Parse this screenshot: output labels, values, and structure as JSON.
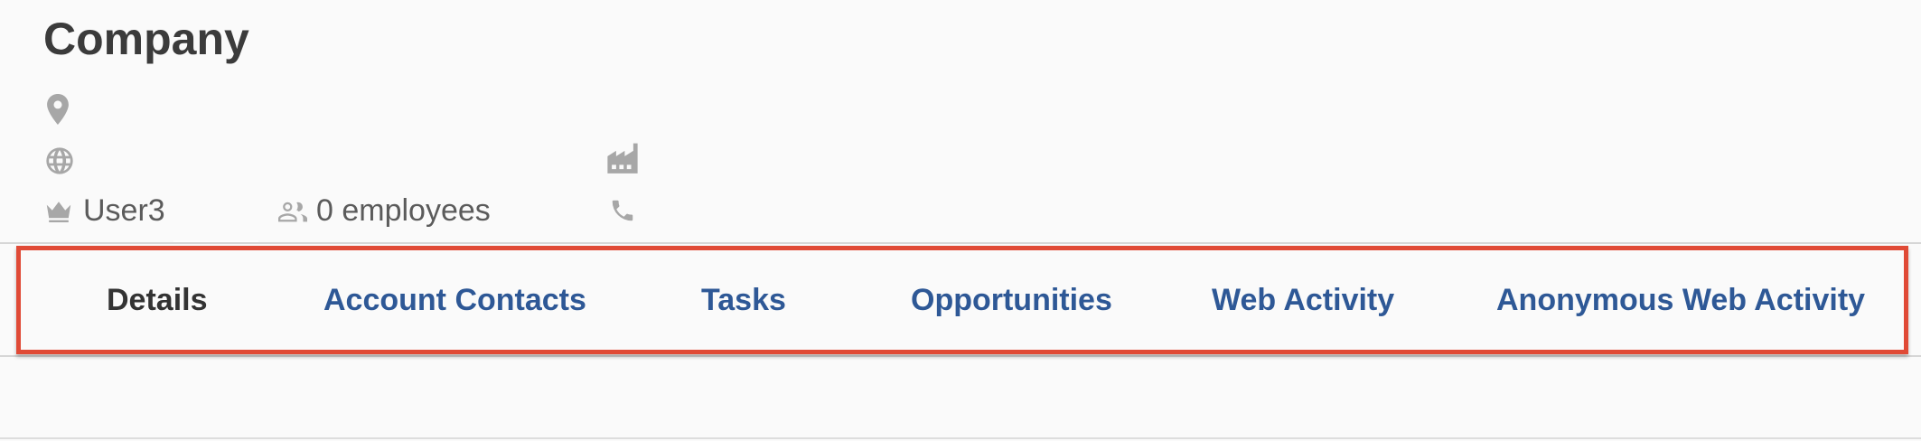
{
  "header": {
    "title": "Company"
  },
  "meta": {
    "owner": "User3",
    "employees": "0 employees",
    "icons": [
      "location-pin-icon",
      "globe-icon",
      "crown-icon",
      "people-icon",
      "factory-icon",
      "phone-icon"
    ]
  },
  "tabs": [
    {
      "label": "Details",
      "active": true
    },
    {
      "label": "Account Contacts",
      "active": false
    },
    {
      "label": "Tasks",
      "active": false
    },
    {
      "label": "Opportunities",
      "active": false
    },
    {
      "label": "Web Activity",
      "active": false
    },
    {
      "label": "Anonymous Web Activity",
      "active": false
    }
  ],
  "colors": {
    "highlight": "#e04a36",
    "tab_link": "#2e5896",
    "icon": "#a7a7a7"
  }
}
